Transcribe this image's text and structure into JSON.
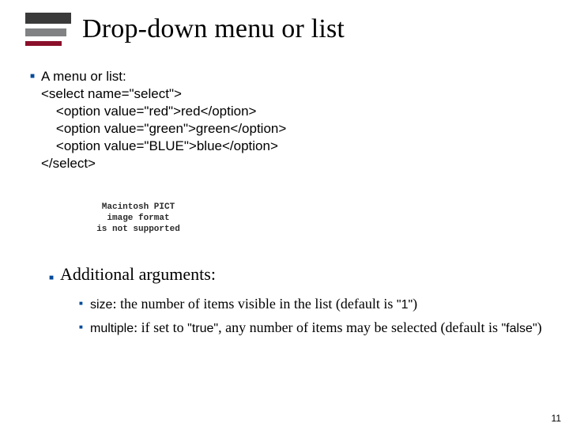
{
  "title": "Drop-down menu or list",
  "bullet1_lead": "A menu or list:",
  "code_line1": "<select name=\"select\">",
  "code_line2": "    <option value=\"red\">red</option>",
  "code_line3": "    <option value=\"green\">green</option>",
  "code_line4": "    <option value=\"BLUE\">blue</option>",
  "code_line5": "</select>",
  "placeholder_text": "Macintosh PICT\nimage format\nis not supported",
  "bullet2": "Additional arguments:",
  "sub1_kw": "size",
  "sub1_a": ": the number of items visible in the list (default is ",
  "sub1_q": "\"1\"",
  "sub1_b": ")",
  "sub2_kw": "multiple",
  "sub2_a": ": if set to ",
  "sub2_q1": "\"true\"",
  "sub2_b": ", any number of items may be selected (default is ",
  "sub2_q2": "\"false\"",
  "sub2_c": ")",
  "page_number": "11"
}
